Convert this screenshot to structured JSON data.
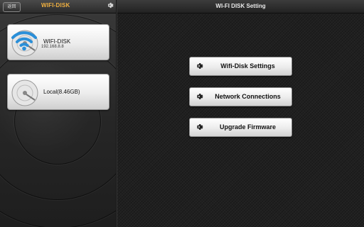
{
  "sidebar": {
    "back_label": "返回",
    "title": "WIFI-DISK",
    "settings_icon": "gear-icon",
    "disks": [
      {
        "name": "WIFI-DISK",
        "sub": "192.168.8.8",
        "icon": "hard-disk-icon",
        "overlay_icon": "wifi-icon"
      },
      {
        "name": "Local(8.46GB)",
        "sub": "",
        "icon": "hard-disk-icon"
      }
    ]
  },
  "main": {
    "title": "WI-FI DISK Setting",
    "buttons": [
      {
        "label": "Wifi-Disk Settings",
        "icon": "gear-icon"
      },
      {
        "label": "Network Connections",
        "icon": "gear-icon"
      },
      {
        "label": "Upgrade Firmware",
        "icon": "gear-icon"
      }
    ]
  },
  "colors": {
    "accent": "#f0b040",
    "wifi": "#2a8fd8",
    "background": "#202020"
  }
}
